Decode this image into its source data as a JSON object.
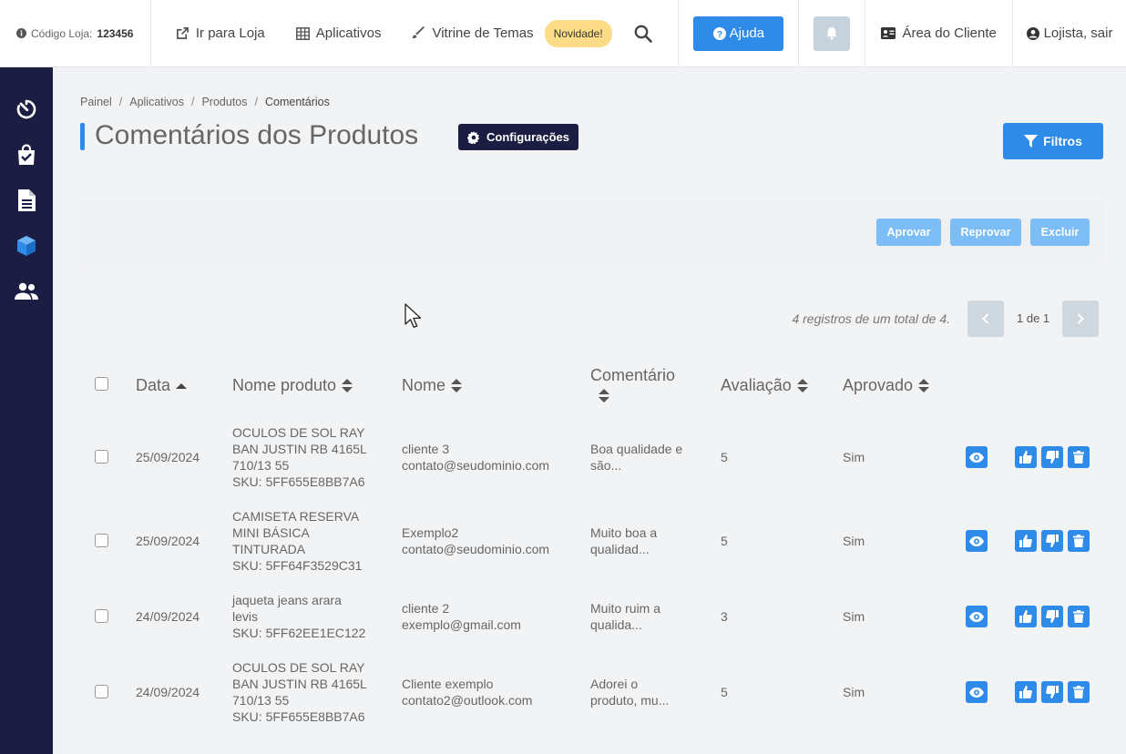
{
  "topbar": {
    "store_label": "Código Loja:",
    "store_code": "123456",
    "nav": [
      {
        "label": "Ir para Loja",
        "icon": "external-link-icon"
      },
      {
        "label": "Aplicativos",
        "icon": "grid-icon"
      },
      {
        "label": "Vitrine de Temas",
        "icon": "brush-icon"
      }
    ],
    "badge": "Novidade!",
    "help_label": "Ajuda",
    "client_area_label": "Área do Cliente",
    "logout_label": "Lojista, sair"
  },
  "sidebar": {
    "items": [
      {
        "icon": "dashboard-gauge-icon"
      },
      {
        "icon": "shopping-bag-icon"
      },
      {
        "icon": "document-icon"
      },
      {
        "icon": "box-icon"
      },
      {
        "icon": "users-icon"
      }
    ]
  },
  "breadcrumb": [
    "Painel",
    "Aplicativos",
    "Produtos",
    "Comentários"
  ],
  "page": {
    "title": "Comentários dos Produtos",
    "config_label": "Configurações",
    "filters_label": "Filtros"
  },
  "actions": {
    "approve": "Aprovar",
    "reject": "Reprovar",
    "delete": "Excluir"
  },
  "pagination": {
    "summary": "4 registros de um total de 4.",
    "page": "1 de 1"
  },
  "table": {
    "headers": {
      "date": "Data",
      "product": "Nome produto",
      "name": "Nome",
      "comment": "Comentário",
      "rating": "Avaliação",
      "approved": "Aprovado"
    },
    "rows": [
      {
        "date": "25/09/2024",
        "product": [
          "OCULOS DE SOL RAY",
          "BAN JUSTIN RB 4165L",
          "710/13 55",
          "SKU: 5FF655E8BB7A6"
        ],
        "name": "cliente 3",
        "email": "contato@seudominio.com",
        "comment": [
          "Boa qualidade e",
          "são..."
        ],
        "rating": "5",
        "approved": "Sim"
      },
      {
        "date": "25/09/2024",
        "product": [
          "CAMISETA RESERVA",
          "MINI BÁSICA",
          "TINTURADA",
          "SKU: 5FF64F3529C31"
        ],
        "name": "Exemplo2",
        "email": "contato@seudominio.com",
        "comment": [
          "Muito boa a",
          "qualidad..."
        ],
        "rating": "5",
        "approved": "Sim"
      },
      {
        "date": "24/09/2024",
        "product": [
          "jaqueta jeans arara",
          "levis",
          "SKU: 5FF62EE1EC122"
        ],
        "name": "cliente 2",
        "email": "exemplo@gmail.com",
        "comment": [
          "Muito ruim a",
          "qualida..."
        ],
        "rating": "3",
        "approved": "Sim"
      },
      {
        "date": "24/09/2024",
        "product": [
          "OCULOS DE SOL RAY",
          "BAN JUSTIN RB 4165L",
          "710/13 55",
          "SKU: 5FF655E8BB7A6"
        ],
        "name": "Cliente exemplo",
        "email": "contato2@outlook.com",
        "comment": [
          "Adorei o",
          "produto, mu..."
        ],
        "rating": "5",
        "approved": "Sim"
      }
    ]
  },
  "colors": {
    "accent": "#2e8be8",
    "sidebar": "#1c1d42",
    "badge": "#fcdc86"
  }
}
